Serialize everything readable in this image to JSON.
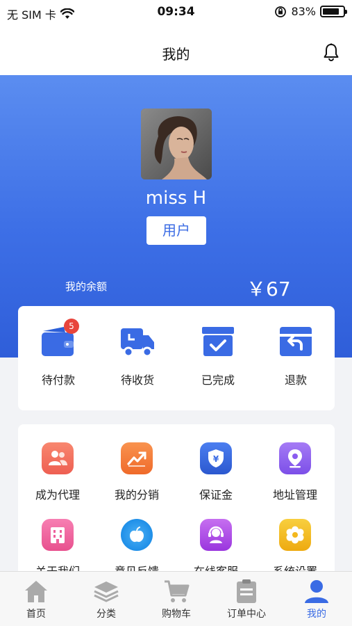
{
  "status_bar": {
    "carrier": "无 SIM 卡",
    "time": "09:34",
    "battery": "83%",
    "battery_level": 0.83
  },
  "nav": {
    "title": "我的"
  },
  "profile": {
    "name": "miss H",
    "role": "用户"
  },
  "balance": {
    "label": "我的余额",
    "value": "￥67"
  },
  "orders": [
    {
      "label": "待付款",
      "icon": "wallet-icon",
      "badge": "5"
    },
    {
      "label": "待收货",
      "icon": "truck-icon"
    },
    {
      "label": "已完成",
      "icon": "completed-box-icon"
    },
    {
      "label": "退款",
      "icon": "refund-icon"
    }
  ],
  "services": [
    {
      "label": "成为代理",
      "icon": "people-icon",
      "color": "#f1705f"
    },
    {
      "label": "我的分销",
      "icon": "trend-chart-icon",
      "color": "#f27a3a"
    },
    {
      "label": "保证金",
      "icon": "shield-yen-icon",
      "color": "#3a6be4"
    },
    {
      "label": "地址管理",
      "icon": "location-icon",
      "color": "#8b5cf0"
    },
    {
      "label": "关于我们",
      "icon": "building-icon",
      "color": "#ee5f9c"
    },
    {
      "label": "意见反馈",
      "icon": "apple-icon",
      "color": "#2a9cf0"
    },
    {
      "label": "在线客服",
      "icon": "customer-service-icon",
      "color": "#b04be8"
    },
    {
      "label": "系统设置",
      "icon": "gear-icon",
      "color": "#f3b81e"
    }
  ],
  "tabs": [
    {
      "label": "首页",
      "icon": "home-icon"
    },
    {
      "label": "分类",
      "icon": "layers-icon"
    },
    {
      "label": "购物车",
      "icon": "cart-icon"
    },
    {
      "label": "订单中心",
      "icon": "clipboard-icon"
    },
    {
      "label": "我的",
      "icon": "user-icon",
      "active": true
    }
  ],
  "colors": {
    "accent": "#3a6be4",
    "badge": "#e8453c"
  }
}
